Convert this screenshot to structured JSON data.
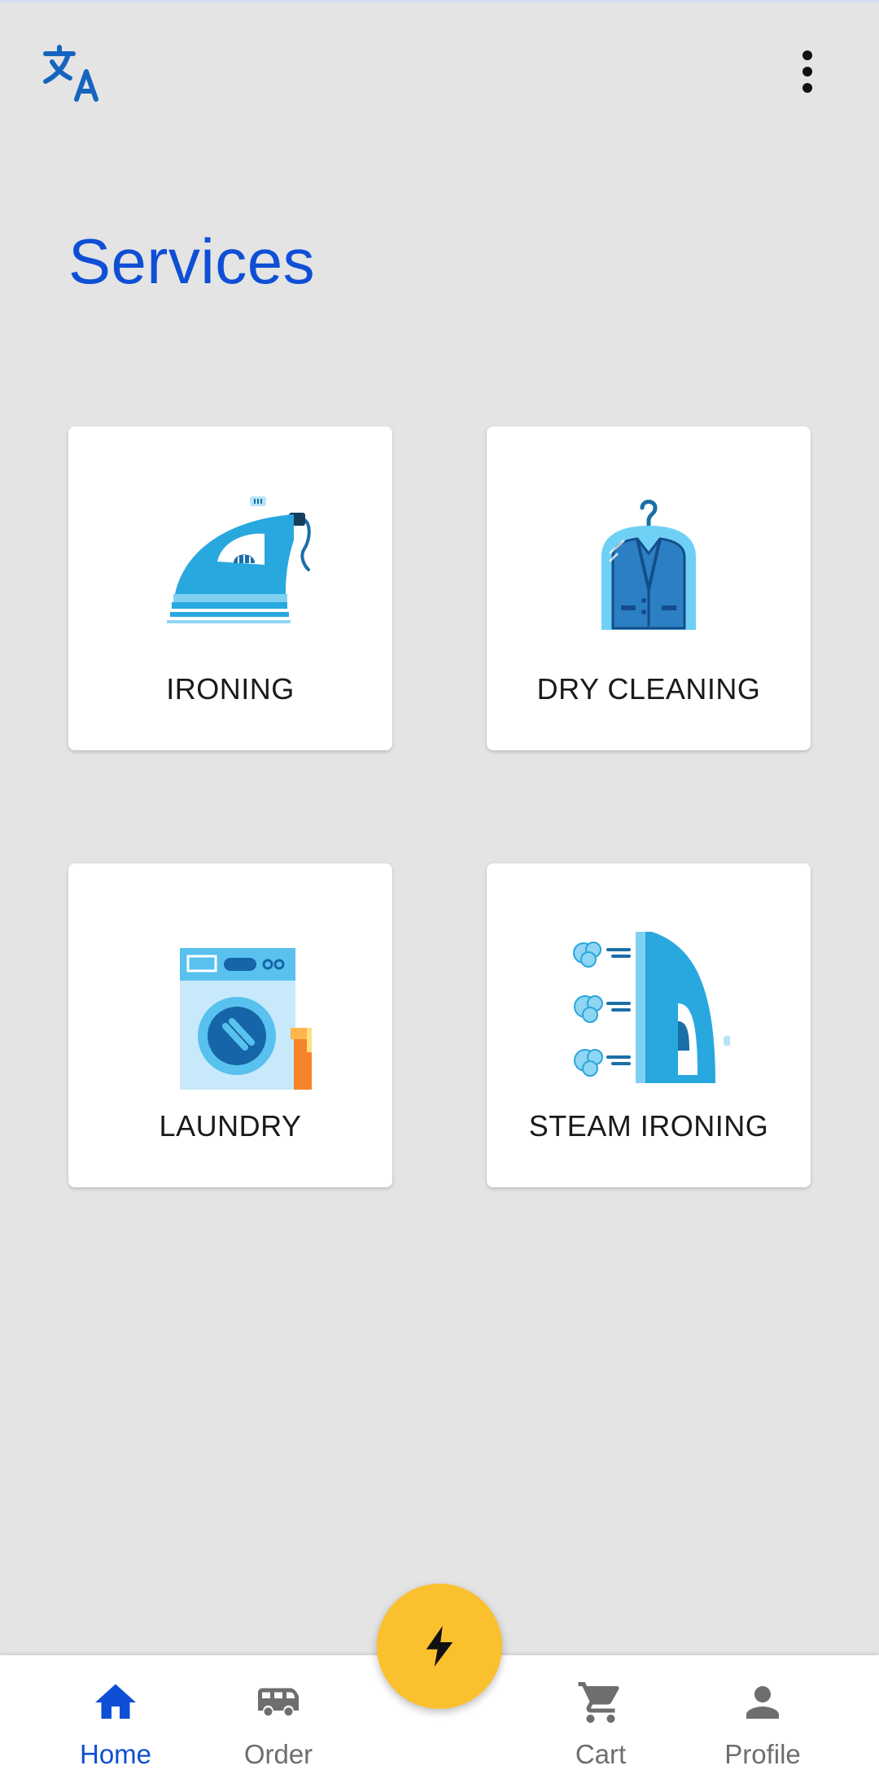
{
  "header": {
    "translate_icon": "translate-icon",
    "menu_icon": "more-vert-icon",
    "title": "Services"
  },
  "services": [
    {
      "label": "IRONING",
      "icon": "iron-icon"
    },
    {
      "label": "DRY CLEANING",
      "icon": "suit-bag-icon"
    },
    {
      "label": "LAUNDRY",
      "icon": "washing-machine-icon"
    },
    {
      "label": "STEAM IRONING",
      "icon": "steam-iron-icon"
    }
  ],
  "fab": {
    "icon": "flash-icon"
  },
  "bottom_nav": {
    "home": {
      "label": "Home",
      "icon": "home-icon",
      "active": true
    },
    "order": {
      "label": "Order",
      "icon": "van-icon"
    },
    "cart": {
      "label": "Cart",
      "icon": "cart-icon"
    },
    "profile": {
      "label": "Profile",
      "icon": "person-icon"
    }
  },
  "colors": {
    "accent": "#0e4fd6",
    "background": "#e4e4e4",
    "fab": "#fbc02d",
    "inactive_nav": "#6e6e6e"
  }
}
